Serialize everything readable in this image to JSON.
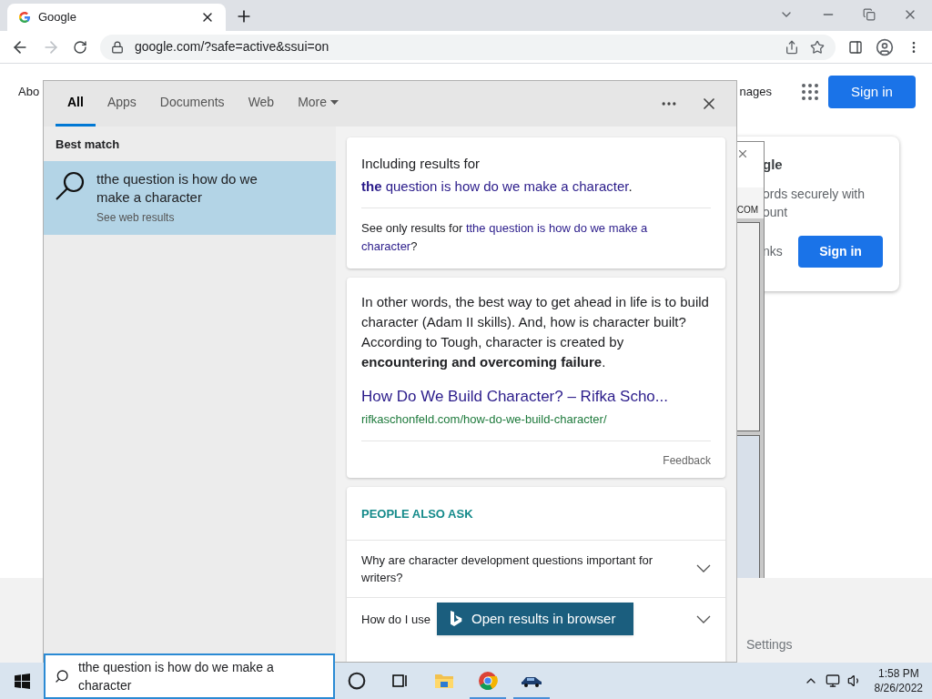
{
  "browser": {
    "tab": {
      "title": "Google",
      "selected": true
    },
    "address": "google.com/?safe=active&ssui=on"
  },
  "page": {
    "about_partial": "Abo",
    "images_partial": "nages",
    "sign_in": "Sign in",
    "card": {
      "title": "gle",
      "lines": [
        "ords securely with",
        "ount"
      ],
      "links_partial": "nks",
      "button": "Sign in"
    },
    "legacy_window": {
      "logo": "COM"
    },
    "footer_link": "Settings"
  },
  "search_panel": {
    "tabs": [
      {
        "label": "All",
        "selected": true,
        "dropdown": false
      },
      {
        "label": "Apps",
        "selected": false,
        "dropdown": false
      },
      {
        "label": "Documents",
        "selected": false,
        "dropdown": false
      },
      {
        "label": "Web",
        "selected": false,
        "dropdown": false
      },
      {
        "label": "More",
        "selected": false,
        "dropdown": true
      }
    ],
    "best_match": {
      "heading": "Best match",
      "title": "tthe question is how do we make a character",
      "subtitle": "See web results",
      "selected": true
    },
    "spelling": {
      "intro": "Including results for",
      "corrected": "**the** question is how do we make a character",
      "corrected_end": ".",
      "see_only_prefix": "See only results for ",
      "see_only_query": "tthe question is how do we make a character",
      "see_only_end": "?"
    },
    "answer": {
      "text": "In other words, the best way to get ahead in life is to build character (Adam II skills). And, how is character built? According to Tough, character is created by **encountering and overcoming failure**.",
      "link_title": "How Do We Build Character? – Rifka Scho...",
      "url": "rifkaschonfeld.com/how-do-we-build-character/",
      "feedback": "Feedback"
    },
    "people_also_ask": {
      "heading": "PEOPLE ALSO ASK",
      "questions": [
        {
          "text": "Why are character development questions important for writers?",
          "expanded": false
        },
        {
          "text": "How do I use",
          "expanded": false
        }
      ]
    },
    "open_button": "Open results in browser"
  },
  "taskbar": {
    "search_query": "tthe question is how do we make a character",
    "apps": [
      {
        "kind": "cortana",
        "running": false
      },
      {
        "kind": "task-view",
        "running": false
      },
      {
        "kind": "explorer",
        "running": false
      },
      {
        "kind": "chrome",
        "running": true
      },
      {
        "kind": "vehicle",
        "running": true
      }
    ],
    "time": "1:58 PM",
    "date": "8/26/2022"
  }
}
